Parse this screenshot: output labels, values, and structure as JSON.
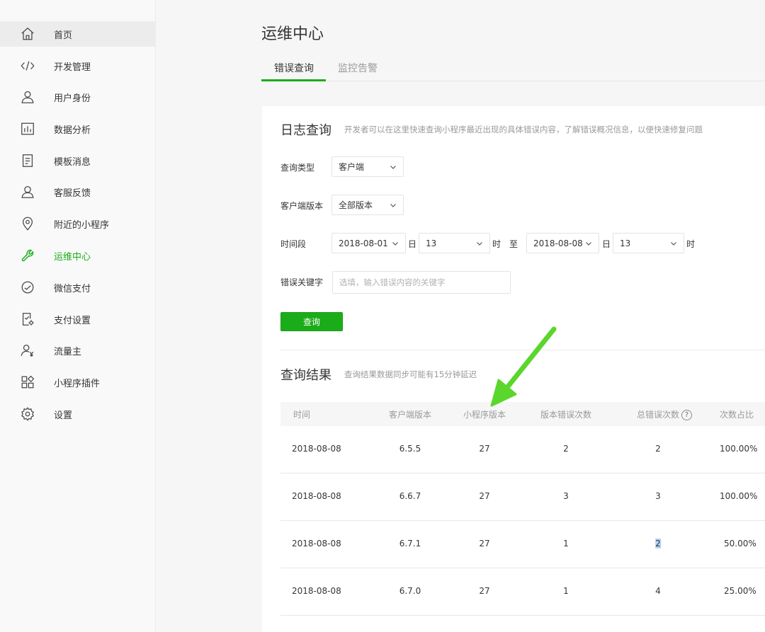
{
  "sidebar": {
    "items": [
      {
        "label": "首页",
        "icon": "home-icon"
      },
      {
        "label": "开发管理",
        "icon": "code-icon"
      },
      {
        "label": "用户身份",
        "icon": "user-icon"
      },
      {
        "label": "数据分析",
        "icon": "bar-chart-icon"
      },
      {
        "label": "模板消息",
        "icon": "document-icon"
      },
      {
        "label": "客服反馈",
        "icon": "customer-service-icon"
      },
      {
        "label": "附近的小程序",
        "icon": "location-pin-icon"
      },
      {
        "label": "运维中心",
        "icon": "wrench-icon"
      },
      {
        "label": "微信支付",
        "icon": "wechat-pay-icon"
      },
      {
        "label": "支付设置",
        "icon": "payment-settings-icon"
      },
      {
        "label": "流量主",
        "icon": "traffic-owner-icon"
      },
      {
        "label": "小程序插件",
        "icon": "plugin-icon"
      },
      {
        "label": "设置",
        "icon": "gear-icon"
      }
    ],
    "active_index": 7,
    "accent_color": "#1aad19"
  },
  "page": {
    "title": "运维中心",
    "tabs": [
      {
        "label": "错误查询",
        "active": true
      },
      {
        "label": "监控告警",
        "active": false
      }
    ]
  },
  "log_query": {
    "title": "日志查询",
    "description": "开发者可以在这里快速查询小程序最近出现的具体错误内容，了解错误概况信息，以便快速修复问题",
    "query_type_label": "查询类型",
    "query_type_value": "客户端",
    "client_version_label": "客户端版本",
    "client_version_value": "全部版本",
    "period_label": "时间段",
    "start_date": "2018-08-01",
    "day_unit": "日",
    "start_hour": "13",
    "hour_unit": "时",
    "to_label": "至",
    "end_date": "2018-08-08",
    "end_hour": "13",
    "keyword_label": "错误关键字",
    "keyword_placeholder": "选填，输入错误内容的关键字",
    "query_button": "查询"
  },
  "results": {
    "title": "查询结果",
    "description": "查询结果数据同步可能有15分钟延迟",
    "columns": [
      "时间",
      "客户端版本",
      "小程序版本",
      "版本错误次数",
      "总错误次数",
      "次数占比"
    ],
    "help_mark": "?",
    "rows": [
      [
        "2018-08-08",
        "6.5.5",
        "27",
        "2",
        "2",
        "100.00%"
      ],
      [
        "2018-08-08",
        "6.6.7",
        "27",
        "3",
        "3",
        "100.00%"
      ],
      [
        "2018-08-08",
        "6.7.1",
        "27",
        "1",
        "2",
        "50.00%"
      ],
      [
        "2018-08-08",
        "6.7.0",
        "27",
        "1",
        "4",
        "25.00%"
      ]
    ],
    "highlighted_cell": {
      "row": 2,
      "column": 4
    }
  }
}
